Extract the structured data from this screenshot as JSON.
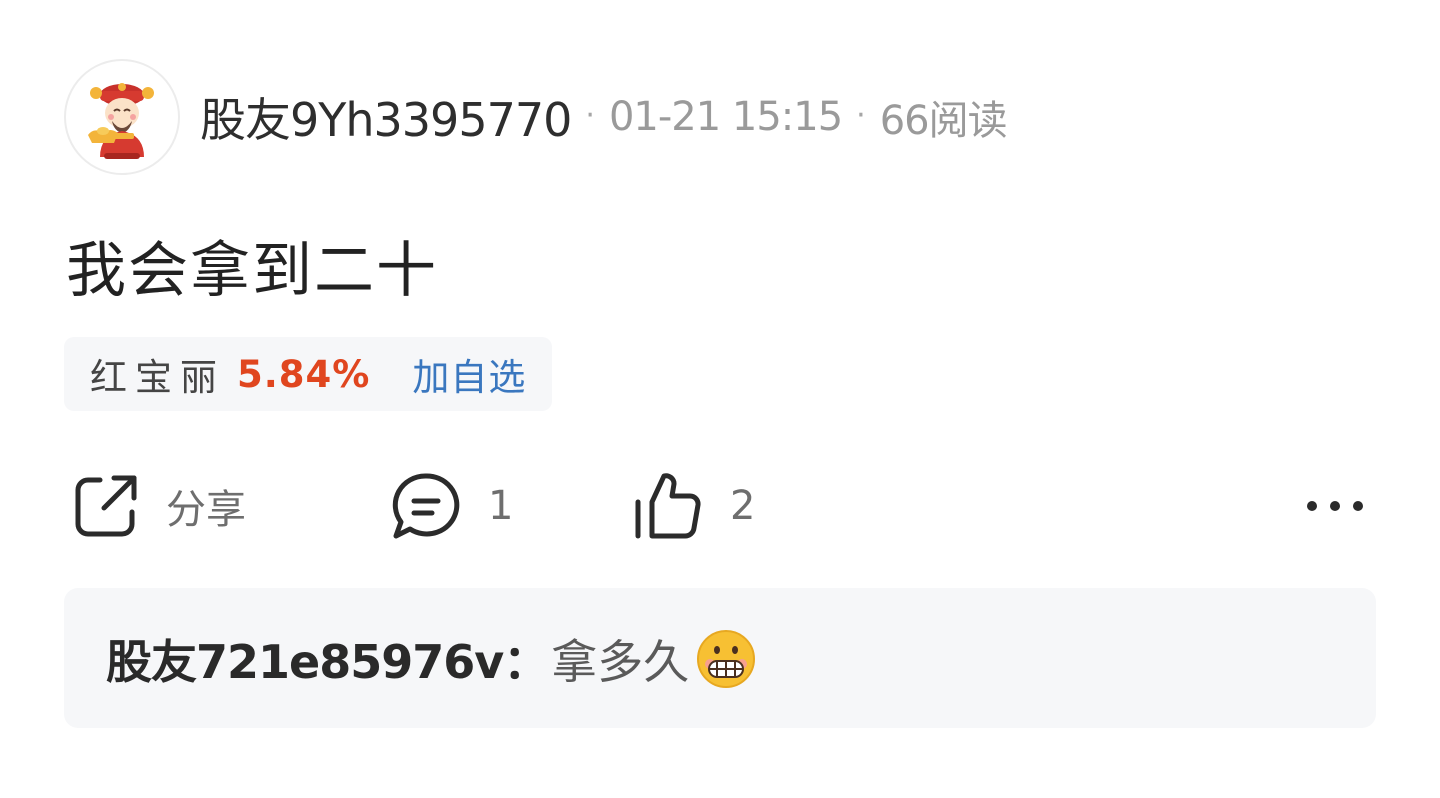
{
  "post": {
    "username": "股友9Yh3395770",
    "dot": "·",
    "time": "01-21 15:15",
    "views": "66阅读",
    "content": "我会拿到二十"
  },
  "stock": {
    "name": "红宝丽",
    "change": "5.84%",
    "watch_label": "加自选",
    "change_color": "#e0461f",
    "watch_color": "#3a77bf"
  },
  "actions": {
    "share_label": "分享",
    "comment_count": "1",
    "like_count": "2",
    "icons": [
      "share-icon",
      "comment-icon",
      "thumbs-up-icon",
      "more-icon"
    ]
  },
  "comment": {
    "user": "股友721e85976v",
    "separator": "：",
    "text": "拿多久",
    "emoji": "grimacing-face-emoji"
  }
}
